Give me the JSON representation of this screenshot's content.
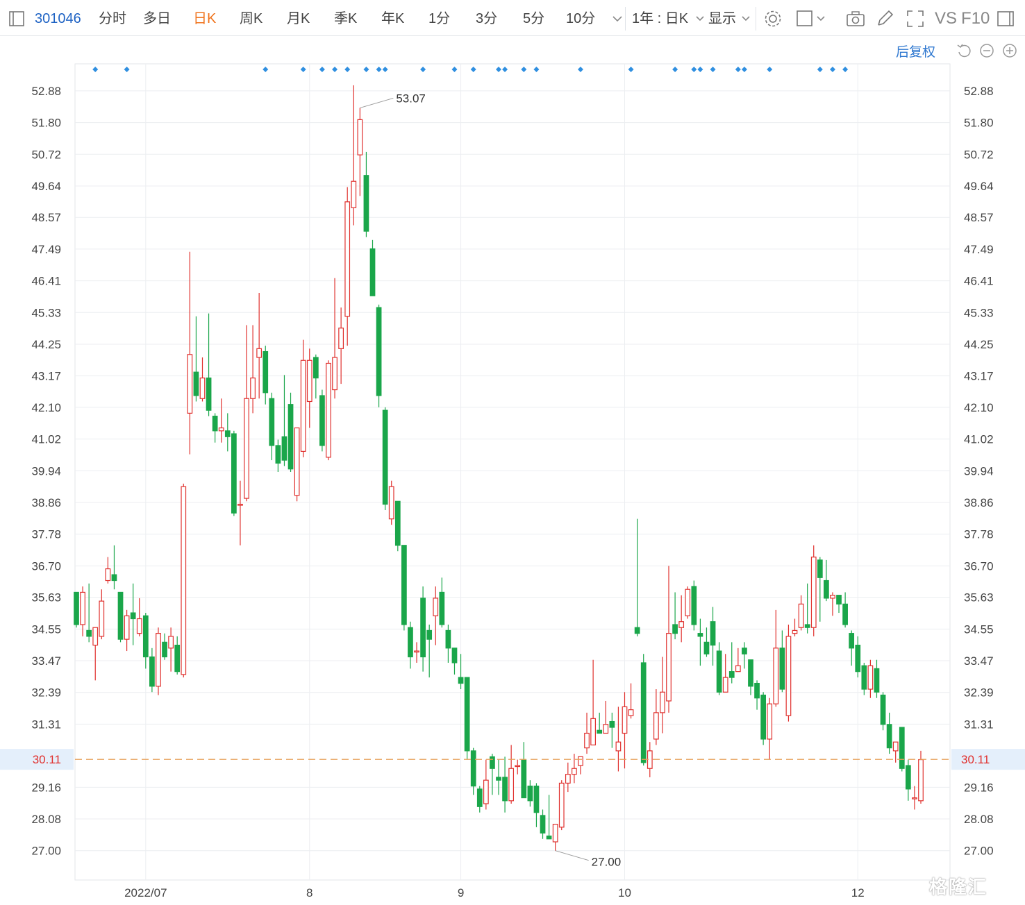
{
  "toolbar": {
    "code": "301046",
    "periods": [
      "分时",
      "多日",
      "日K",
      "周K",
      "月K",
      "季K",
      "年K",
      "1分",
      "3分",
      "5分",
      "10分"
    ],
    "active": "日K",
    "range_label": "1年 : 日K",
    "display_label": "显示",
    "vs_label": "VS",
    "f10_label": "F10"
  },
  "fuquan_label": "后复权",
  "watermark": "格隆汇",
  "colors": {
    "up": "#e0302d",
    "down": "#1aa64a",
    "current_line": "#e8a05a",
    "grid": "#eceef1",
    "dot": "#2f8fe0",
    "accent": "#f0741e"
  },
  "chart_data": {
    "type": "candlestick",
    "x_ticks": [
      "2022/07",
      "8",
      "9",
      "10",
      "12"
    ],
    "y_ticks": [
      52.88,
      51.8,
      50.72,
      49.64,
      48.57,
      47.49,
      46.41,
      45.33,
      44.25,
      43.17,
      42.1,
      41.02,
      39.94,
      38.86,
      37.78,
      36.7,
      35.63,
      34.55,
      33.47,
      32.39,
      31.31,
      29.16,
      28.08,
      27.0
    ],
    "ylim": [
      26.0,
      54.0
    ],
    "current_price": 30.11,
    "current_price_label": "30.11",
    "max_label": "53.07",
    "min_label": "27.00",
    "max_index": 45,
    "min_index": 76,
    "event_marker_indices": [
      3,
      8,
      30,
      36,
      39,
      41,
      43,
      46,
      48,
      49,
      55,
      60,
      63,
      67,
      68,
      71,
      73,
      80,
      88,
      95,
      98,
      99,
      101,
      105,
      106,
      110,
      118,
      120,
      122
    ],
    "candles": [
      [
        35.8,
        34.7,
        35.8,
        34.6
      ],
      [
        34.7,
        35.8,
        36.0,
        34.3
      ],
      [
        34.5,
        34.3,
        36.1,
        34.1
      ],
      [
        34.0,
        34.6,
        34.6,
        32.8
      ],
      [
        34.3,
        35.5,
        35.9,
        34.2
      ],
      [
        36.2,
        36.6,
        37.0,
        36.1
      ],
      [
        36.4,
        36.2,
        37.4,
        35.9
      ],
      [
        35.8,
        34.2,
        35.8,
        34.1
      ],
      [
        34.2,
        35.0,
        35.2,
        33.8
      ],
      [
        35.1,
        34.9,
        36.1,
        34.0
      ],
      [
        34.4,
        34.9,
        35.6,
        34.3
      ],
      [
        35.0,
        33.6,
        35.1,
        33.2
      ],
      [
        33.6,
        32.6,
        33.9,
        32.4
      ],
      [
        32.6,
        34.4,
        34.6,
        32.3
      ],
      [
        34.1,
        33.6,
        34.4,
        33.5
      ],
      [
        33.9,
        34.3,
        34.6,
        33.1
      ],
      [
        34.0,
        33.1,
        34.3,
        33.0
      ],
      [
        33.0,
        39.4,
        39.5,
        32.9
      ],
      [
        41.9,
        43.9,
        47.4,
        40.5
      ],
      [
        43.3,
        42.5,
        45.2,
        42.3
      ],
      [
        42.4,
        43.1,
        43.8,
        42.3
      ],
      [
        43.1,
        42.0,
        45.3,
        41.8
      ],
      [
        41.8,
        41.3,
        41.9,
        40.9
      ],
      [
        41.3,
        41.4,
        42.4,
        40.9
      ],
      [
        41.3,
        41.1,
        41.9,
        40.6
      ],
      [
        41.2,
        38.5,
        41.3,
        38.4
      ],
      [
        38.8,
        38.8,
        39.6,
        37.4
      ],
      [
        39.0,
        42.4,
        44.9,
        38.9
      ],
      [
        42.4,
        43.1,
        44.9,
        41.9
      ],
      [
        43.8,
        44.1,
        46.0,
        42.4
      ],
      [
        44.0,
        42.6,
        44.2,
        42.2
      ],
      [
        42.4,
        40.8,
        42.6,
        40.3
      ],
      [
        40.8,
        40.2,
        41.0,
        39.9
      ],
      [
        41.1,
        40.3,
        43.2,
        40.1
      ],
      [
        42.2,
        40.0,
        42.6,
        39.9
      ],
      [
        39.1,
        41.4,
        41.4,
        38.9
      ],
      [
        40.6,
        43.7,
        44.4,
        40.4
      ],
      [
        42.3,
        43.7,
        44.1,
        41.4
      ],
      [
        43.8,
        43.1,
        43.9,
        42.4
      ],
      [
        42.5,
        40.8,
        42.7,
        40.6
      ],
      [
        40.4,
        43.6,
        43.7,
        40.3
      ],
      [
        42.7,
        43.8,
        46.5,
        42.4
      ],
      [
        44.1,
        44.8,
        45.5,
        42.9
      ],
      [
        45.2,
        49.1,
        49.6,
        44.2
      ],
      [
        48.9,
        49.8,
        53.07,
        48.3
      ],
      [
        50.7,
        51.9,
        52.3,
        49.3
      ],
      [
        50.0,
        48.1,
        50.8,
        47.9
      ],
      [
        47.5,
        45.9,
        47.8,
        45.9
      ],
      [
        45.5,
        42.5,
        45.6,
        42.1
      ],
      [
        42.0,
        38.8,
        42.1,
        38.6
      ],
      [
        38.3,
        39.4,
        39.6,
        38.1
      ],
      [
        38.9,
        37.4,
        38.9,
        37.2
      ],
      [
        37.4,
        34.7,
        37.4,
        34.5
      ],
      [
        34.6,
        33.6,
        34.8,
        33.2
      ],
      [
        33.8,
        33.8,
        34.1,
        33.4
      ],
      [
        35.6,
        33.6,
        36.0,
        33.1
      ],
      [
        34.5,
        34.2,
        34.7,
        32.9
      ],
      [
        35.0,
        35.6,
        36.0,
        34.0
      ],
      [
        35.8,
        34.7,
        36.3,
        34.6
      ],
      [
        34.5,
        33.9,
        34.7,
        33.4
      ],
      [
        33.9,
        33.4,
        33.9,
        33.0
      ],
      [
        32.9,
        32.7,
        33.7,
        32.5
      ],
      [
        32.9,
        30.4,
        32.9,
        30.1
      ],
      [
        30.4,
        29.2,
        30.5,
        28.9
      ],
      [
        29.1,
        28.5,
        29.2,
        28.3
      ],
      [
        28.6,
        29.4,
        30.1,
        28.4
      ],
      [
        30.2,
        29.8,
        30.3,
        28.9
      ],
      [
        29.5,
        29.4,
        30.1,
        28.9
      ],
      [
        29.5,
        28.7,
        30.2,
        28.3
      ],
      [
        28.7,
        29.8,
        30.6,
        28.6
      ],
      [
        29.9,
        29.9,
        30.1,
        29.6
      ],
      [
        30.1,
        28.8,
        30.7,
        28.8
      ],
      [
        29.2,
        28.7,
        29.4,
        28.5
      ],
      [
        29.2,
        28.3,
        29.3,
        27.8
      ],
      [
        28.2,
        27.6,
        28.4,
        27.4
      ],
      [
        27.5,
        27.4,
        28.9,
        27.4
      ],
      [
        27.3,
        27.9,
        27.9,
        27.0
      ],
      [
        27.8,
        29.3,
        29.4,
        27.7
      ],
      [
        29.3,
        29.6,
        30.0,
        29.0
      ],
      [
        29.6,
        29.8,
        30.3,
        29.3
      ],
      [
        29.9,
        30.2,
        30.2,
        29.6
      ],
      [
        30.5,
        31.0,
        31.7,
        30.3
      ],
      [
        30.6,
        31.5,
        33.5,
        30.6
      ],
      [
        31.1,
        31.0,
        31.7,
        31.0
      ],
      [
        31.0,
        31.3,
        32.1,
        31.0
      ],
      [
        31.4,
        31.2,
        31.7,
        30.5
      ],
      [
        30.4,
        30.7,
        31.9,
        29.7
      ],
      [
        31.0,
        31.9,
        32.4,
        29.8
      ],
      [
        31.6,
        31.8,
        32.7,
        31.5
      ],
      [
        34.6,
        34.4,
        38.3,
        34.3
      ],
      [
        33.4,
        30.0,
        33.7,
        29.9
      ],
      [
        29.8,
        30.4,
        30.7,
        29.5
      ],
      [
        30.8,
        31.7,
        32.5,
        30.6
      ],
      [
        31.7,
        32.4,
        33.6,
        31.0
      ],
      [
        32.1,
        34.4,
        36.7,
        31.7
      ],
      [
        34.7,
        34.4,
        35.8,
        34.2
      ],
      [
        34.6,
        34.8,
        35.7,
        34.1
      ],
      [
        35.0,
        35.9,
        36.0,
        34.9
      ],
      [
        36.0,
        34.7,
        36.2,
        34.5
      ],
      [
        34.4,
        34.3,
        34.9,
        33.3
      ],
      [
        34.1,
        33.7,
        34.6,
        33.6
      ],
      [
        34.8,
        34.0,
        35.3,
        33.3
      ],
      [
        33.8,
        32.4,
        34.1,
        32.3
      ],
      [
        32.4,
        32.9,
        33.7,
        32.4
      ],
      [
        33.1,
        32.9,
        34.1,
        32.7
      ],
      [
        33.1,
        33.3,
        33.9,
        33.2
      ],
      [
        33.9,
        33.7,
        34.1,
        33.2
      ],
      [
        33.5,
        32.6,
        33.5,
        32.3
      ],
      [
        32.7,
        32.2,
        32.8,
        31.8
      ],
      [
        32.3,
        30.8,
        32.4,
        30.6
      ],
      [
        30.8,
        32.0,
        32.2,
        30.1
      ],
      [
        32.0,
        33.9,
        35.2,
        31.9
      ],
      [
        33.9,
        32.5,
        34.5,
        32.4
      ],
      [
        31.6,
        34.3,
        34.7,
        31.4
      ],
      [
        34.4,
        34.5,
        34.9,
        34.3
      ],
      [
        34.6,
        35.4,
        35.7,
        34.5
      ],
      [
        34.7,
        34.6,
        36.1,
        34.4
      ],
      [
        34.6,
        37.0,
        37.4,
        34.3
      ],
      [
        36.9,
        36.3,
        37.0,
        34.8
      ],
      [
        36.2,
        35.6,
        36.9,
        35.5
      ],
      [
        35.6,
        35.7,
        35.8,
        35.0
      ],
      [
        35.7,
        35.4,
        35.7,
        35.1
      ],
      [
        35.4,
        34.7,
        35.8,
        34.6
      ],
      [
        34.4,
        33.9,
        34.5,
        33.3
      ],
      [
        34.0,
        33.1,
        34.3,
        32.9
      ],
      [
        33.3,
        32.5,
        33.4,
        32.3
      ],
      [
        32.5,
        33.3,
        33.5,
        32.2
      ],
      [
        33.2,
        32.4,
        33.5,
        32.2
      ],
      [
        32.3,
        31.3,
        32.4,
        31.1
      ],
      [
        31.3,
        30.5,
        31.7,
        30.3
      ],
      [
        30.4,
        30.7,
        30.7,
        30.0
      ],
      [
        31.2,
        29.8,
        31.2,
        29.7
      ],
      [
        29.9,
        29.1,
        30.1,
        28.7
      ],
      [
        28.8,
        28.8,
        29.2,
        28.4
      ],
      [
        28.7,
        30.1,
        30.4,
        28.6
      ]
    ]
  }
}
